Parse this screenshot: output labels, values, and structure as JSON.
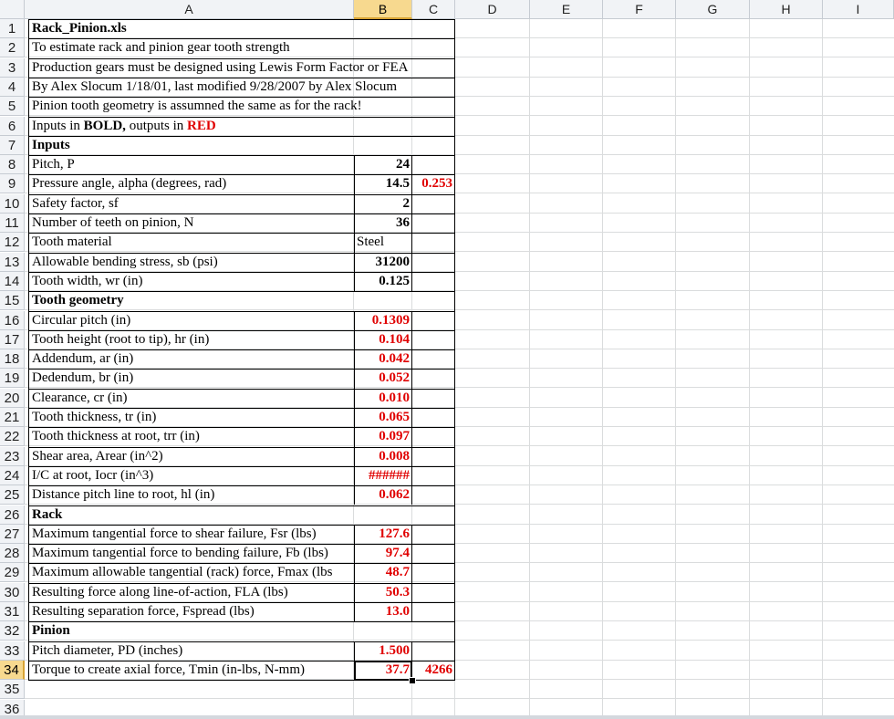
{
  "columns": [
    "A",
    "B",
    "C",
    "D",
    "E",
    "F",
    "G",
    "H",
    "I"
  ],
  "rows": [
    {
      "n": "1",
      "a": "Rack_Pinion.xls",
      "a_style": "bold",
      "b": "",
      "b_style": "",
      "c": "",
      "c_style": ""
    },
    {
      "n": "2",
      "a": "To estimate rack and pinion gear tooth strength",
      "a_style": "",
      "b": "",
      "b_style": "",
      "c": "",
      "c_style": ""
    },
    {
      "n": "3",
      "a": "Production gears must be designed using Lewis Form Factor or FEA",
      "a_style": "",
      "b": "",
      "b_style": "",
      "c": "",
      "c_style": ""
    },
    {
      "n": "4",
      "a": "By Alex Slocum 1/18/01, last modified 9/28/2007 by Alex Slocum",
      "a_style": "",
      "b": "",
      "b_style": "",
      "c": "",
      "c_style": ""
    },
    {
      "n": "5",
      "a": "Pinion tooth geometry is assumned the same as for the rack!",
      "a_style": "",
      "b": "",
      "b_style": "",
      "c": "",
      "c_style": ""
    },
    {
      "n": "6",
      "a": "",
      "a_style": "",
      "b": "",
      "b_style": "",
      "c": "",
      "c_style": "",
      "rich": true
    },
    {
      "n": "7",
      "a": "Inputs",
      "a_style": "bold",
      "b": "",
      "b_style": "",
      "c": "",
      "c_style": ""
    },
    {
      "n": "8",
      "a": "Pitch, P",
      "a_style": "",
      "b": "24",
      "b_style": "bold",
      "c": "",
      "c_style": ""
    },
    {
      "n": "9",
      "a": "Pressure angle, alpha (degrees, rad)",
      "a_style": "",
      "b": "14.5",
      "b_style": "bold",
      "c": "0.253",
      "c_style": "red"
    },
    {
      "n": "10",
      "a": "Safety factor, sf",
      "a_style": "",
      "b": "2",
      "b_style": "bold",
      "c": "",
      "c_style": ""
    },
    {
      "n": "11",
      "a": "Number of teeth on pinion, N",
      "a_style": "",
      "b": "36",
      "b_style": "bold",
      "c": "",
      "c_style": ""
    },
    {
      "n": "12",
      "a": "Tooth material",
      "a_style": "",
      "b": "Steel",
      "b_style": "left",
      "c": "",
      "c_style": ""
    },
    {
      "n": "13",
      "a": "Allowable bending stress, sb (psi)",
      "a_style": "",
      "b": "31200",
      "b_style": "bold",
      "c": "",
      "c_style": ""
    },
    {
      "n": "14",
      "a": "Tooth width, wr (in)",
      "a_style": "",
      "b": "0.125",
      "b_style": "bold",
      "c": "",
      "c_style": ""
    },
    {
      "n": "15",
      "a": "Tooth geometry",
      "a_style": "bold",
      "b": "",
      "b_style": "",
      "c": "",
      "c_style": ""
    },
    {
      "n": "16",
      "a": "Circular pitch (in)",
      "a_style": "",
      "b": "0.1309",
      "b_style": "red",
      "c": "",
      "c_style": ""
    },
    {
      "n": "17",
      "a": "Tooth height (root to tip), hr (in)",
      "a_style": "",
      "b": "0.104",
      "b_style": "red",
      "c": "",
      "c_style": ""
    },
    {
      "n": "18",
      "a": "Addendum, ar (in)",
      "a_style": "",
      "b": "0.042",
      "b_style": "red",
      "c": "",
      "c_style": ""
    },
    {
      "n": "19",
      "a": "Dedendum, br (in)",
      "a_style": "",
      "b": "0.052",
      "b_style": "red",
      "c": "",
      "c_style": ""
    },
    {
      "n": "20",
      "a": "Clearance, cr (in)",
      "a_style": "",
      "b": "0.010",
      "b_style": "red",
      "c": "",
      "c_style": ""
    },
    {
      "n": "21",
      "a": "Tooth thickness, tr (in)",
      "a_style": "",
      "b": "0.065",
      "b_style": "red",
      "c": "",
      "c_style": ""
    },
    {
      "n": "22",
      "a": "Tooth thickness at root, trr (in)",
      "a_style": "",
      "b": "0.097",
      "b_style": "red",
      "c": "",
      "c_style": ""
    },
    {
      "n": "23",
      "a": "Shear area, Arear (in^2)",
      "a_style": "",
      "b": "0.008",
      "b_style": "red",
      "c": "",
      "c_style": ""
    },
    {
      "n": "24",
      "a": "I/C at root, Iocr (in^3)",
      "a_style": "",
      "b": "######",
      "b_style": "red",
      "c": "",
      "c_style": ""
    },
    {
      "n": "25",
      "a": "Distance pitch line to root, hl (in)",
      "a_style": "",
      "b": "0.062",
      "b_style": "red",
      "c": "",
      "c_style": ""
    },
    {
      "n": "26",
      "a": "Rack",
      "a_style": "bold",
      "b": "",
      "b_style": "",
      "c": "",
      "c_style": ""
    },
    {
      "n": "27",
      "a": "Maximum tangential force to shear failure, Fsr (lbs)",
      "a_style": "",
      "b": "127.6",
      "b_style": "red",
      "c": "",
      "c_style": ""
    },
    {
      "n": "28",
      "a": "Maximum tangential force to bending failure, Fb (lbs)",
      "a_style": "",
      "b": "97.4",
      "b_style": "red",
      "c": "",
      "c_style": ""
    },
    {
      "n": "29",
      "a": "Maximum allowable tangential (rack) force, Fmax (lbs",
      "a_style": "",
      "b": "48.7",
      "b_style": "red",
      "c": "",
      "c_style": ""
    },
    {
      "n": "30",
      "a": "Resulting force along line-of-action, FLA (lbs)",
      "a_style": "",
      "b": "50.3",
      "b_style": "red",
      "c": "",
      "c_style": ""
    },
    {
      "n": "31",
      "a": "Resulting separation force, Fspread (lbs)",
      "a_style": "",
      "b": "13.0",
      "b_style": "red",
      "c": "",
      "c_style": ""
    },
    {
      "n": "32",
      "a": "Pinion",
      "a_style": "bold",
      "b": "",
      "b_style": "",
      "c": "",
      "c_style": ""
    },
    {
      "n": "33",
      "a": "Pitch diameter, PD (inches)",
      "a_style": "",
      "b": "1.500",
      "b_style": "red",
      "c": "",
      "c_style": ""
    },
    {
      "n": "34",
      "a": "Torque to create axial force, Tmin (in-lbs, N-mm)",
      "a_style": "",
      "b": "37.7",
      "b_style": "red",
      "c": "4266",
      "c_style": "red"
    },
    {
      "n": "35",
      "a": "",
      "a_style": "",
      "b": "",
      "b_style": "",
      "c": "",
      "c_style": ""
    },
    {
      "n": "36",
      "a": "",
      "a_style": "",
      "b": "",
      "b_style": "",
      "c": "",
      "c_style": ""
    }
  ],
  "row6_rich": {
    "part1": "Inputs in ",
    "part2": "BOLD,",
    "part3": " outputs in ",
    "part4": "RED"
  },
  "selected_cell": "B34",
  "colors": {
    "output_red": "#e00000",
    "header_bg": "#f1f3f6",
    "selected_header_bg": "#f7d98f",
    "gridline": "#dadcdd"
  }
}
